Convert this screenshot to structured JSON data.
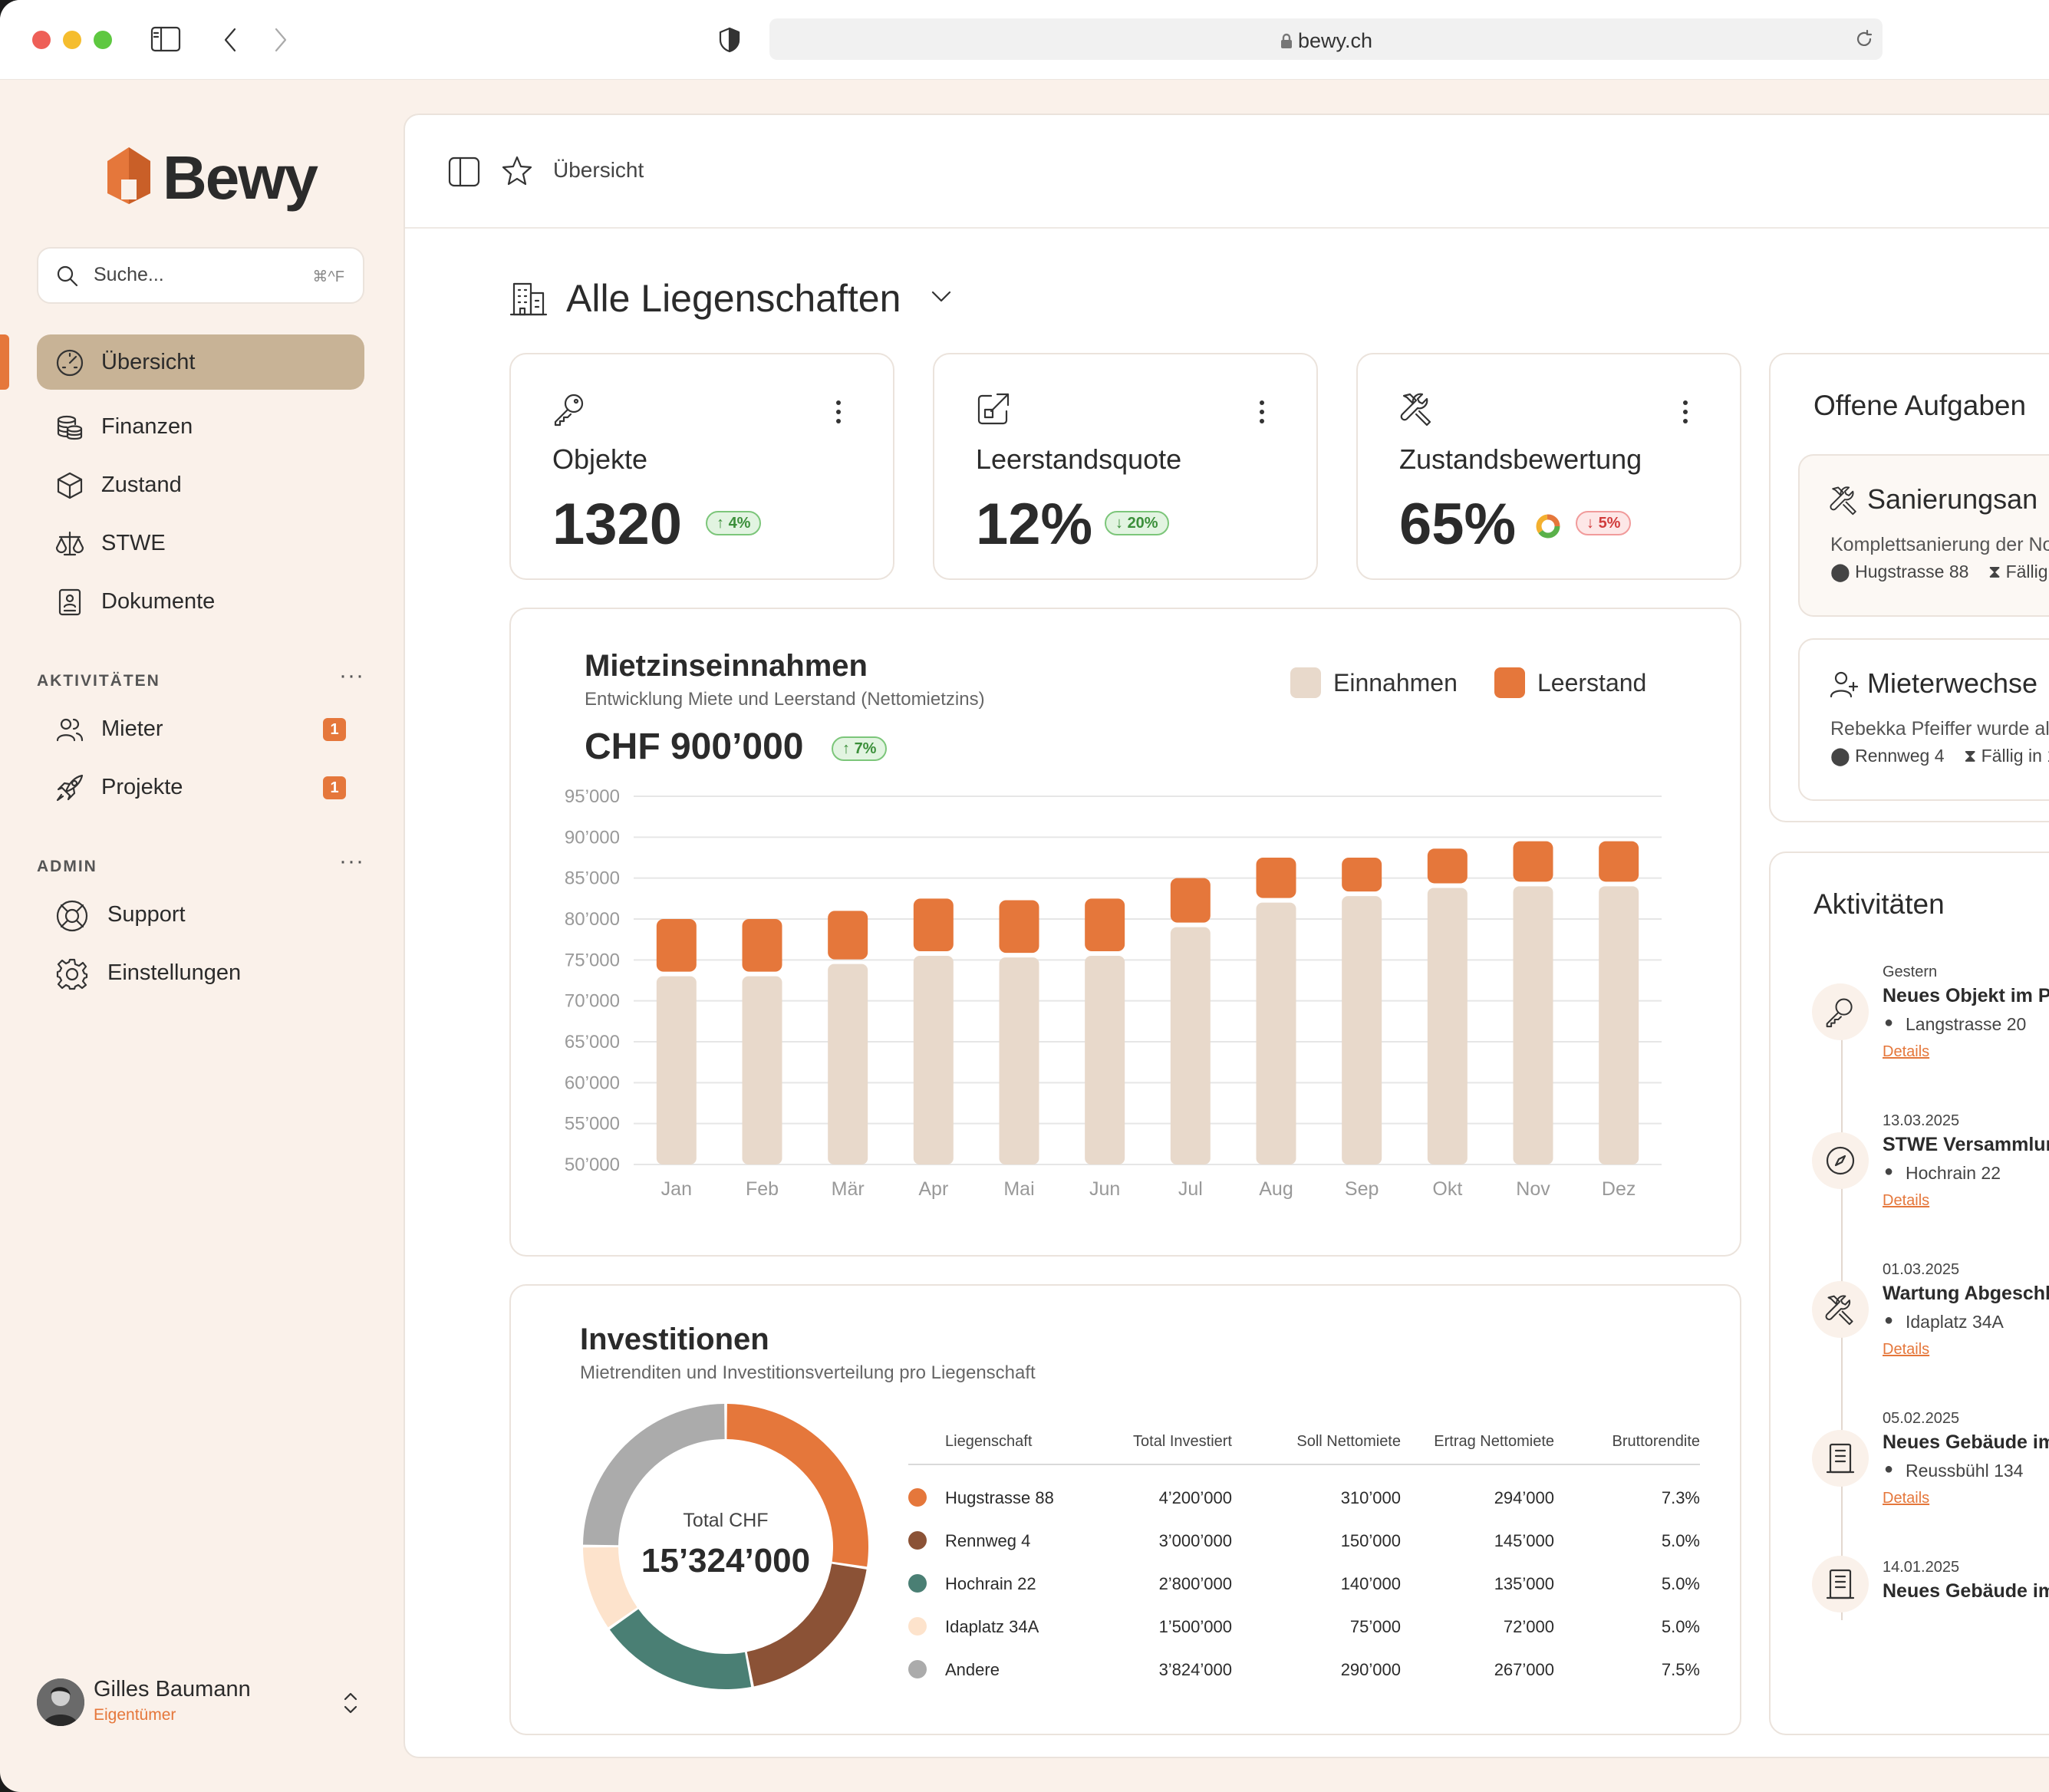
{
  "browser": {
    "url": "bewy.ch"
  },
  "brand": {
    "name": "Bewy",
    "accent": "#e5773b",
    "active_nav": "#c8b396"
  },
  "search": {
    "placeholder": "Suche...",
    "shortcut": "⌘^F"
  },
  "nav": {
    "main": [
      {
        "label": "Übersicht",
        "icon": "gauge-icon",
        "active": true
      },
      {
        "label": "Finanzen",
        "icon": "coins-icon"
      },
      {
        "label": "Zustand",
        "icon": "cube-icon"
      },
      {
        "label": "STWE",
        "icon": "scale-icon"
      },
      {
        "label": "Dokumente",
        "icon": "document-icon"
      }
    ],
    "activities_label": "AKTIVITÄTEN",
    "activities": [
      {
        "label": "Mieter",
        "icon": "users-icon",
        "badge": "1"
      },
      {
        "label": "Projekte",
        "icon": "rocket-icon",
        "badge": "1"
      }
    ],
    "admin_label": "ADMIN",
    "admin": [
      {
        "label": "Support",
        "icon": "lifebuoy-icon"
      },
      {
        "label": "Einstellungen",
        "icon": "gear-icon"
      }
    ]
  },
  "user": {
    "name": "Gilles Baumann",
    "role": "Eigentümer"
  },
  "header": {
    "breadcrumb": "Übersicht"
  },
  "page": {
    "title": "Alle Liegenschaften"
  },
  "kpis": [
    {
      "label": "Objekte",
      "value": "1320",
      "change": "4%",
      "direction": "up",
      "icon": "key-icon"
    },
    {
      "label": "Leerstandsquote",
      "value": "12%",
      "change": "20%",
      "direction": "down",
      "icon": "external-link-icon"
    },
    {
      "label": "Zustandsbewertung",
      "value": "65%",
      "change": "5%",
      "direction": "down",
      "icon": "tools-icon"
    }
  ],
  "rent_chart": {
    "title": "Mietzinseinnahmen",
    "subtitle": "Entwicklung Miete und Leerstand (Nettomietzins)",
    "total": "CHF 900’000",
    "change": "7%",
    "legend": [
      "Einnahmen",
      "Leerstand"
    ]
  },
  "chart_data": {
    "type": "bar",
    "stacked": true,
    "categories": [
      "Jan",
      "Feb",
      "Mär",
      "Apr",
      "Mai",
      "Jun",
      "Jul",
      "Aug",
      "Sep",
      "Okt",
      "Nov",
      "Dez"
    ],
    "series": [
      {
        "name": "Einnahmen",
        "color": "#e8d9cb",
        "values": [
          73000,
          73000,
          74500,
          75500,
          75300,
          75500,
          79000,
          82000,
          82800,
          83800,
          84000,
          84000
        ]
      },
      {
        "name": "Leerstand",
        "color": "#e5773b",
        "values": [
          7000,
          7000,
          6500,
          7000,
          7000,
          7000,
          6000,
          5500,
          4700,
          4800,
          5500,
          5500
        ]
      }
    ],
    "ylim": [
      50000,
      95000
    ],
    "yticks": [
      "95’000",
      "90’000",
      "85’000",
      "80’000",
      "75’000",
      "70’000",
      "65’000",
      "60’000",
      "55’000",
      "50’000"
    ],
    "grid": true,
    "legend_position": "top-right"
  },
  "investments": {
    "title": "Investitionen",
    "subtitle": "Mietrenditen und Investitionsverteilung pro Liegenschaft",
    "donut_label": "Total CHF",
    "donut_value": "15’324’000",
    "headers": [
      "Liegenschaft",
      "Total Investiert",
      "Soll Nettomiete",
      "Ertrag Nettomiete",
      "Bruttorendite"
    ],
    "rows": [
      {
        "name": "Hugstrasse 88",
        "invested": "4’200’000",
        "soll": "310’000",
        "ertrag": "294’000",
        "rendite": "7.3%",
        "color": "#e5773b",
        "amount": 4200000
      },
      {
        "name": "Rennweg 4",
        "invested": "3’000’000",
        "soll": "150’000",
        "ertrag": "145’000",
        "rendite": "5.0%",
        "color": "#8b5236",
        "amount": 3000000
      },
      {
        "name": "Hochrain 22",
        "invested": "2’800’000",
        "soll": "140’000",
        "ertrag": "135’000",
        "rendite": "5.0%",
        "color": "#4a7f74",
        "amount": 2800000
      },
      {
        "name": "Idaplatz 34A",
        "invested": "1’500’000",
        "soll": "75’000",
        "ertrag": "72’000",
        "rendite": "5.0%",
        "color": "#fde3cc",
        "amount": 1500000
      },
      {
        "name": "Andere",
        "invested": "3’824’000",
        "soll": "290’000",
        "ertrag": "267’000",
        "rendite": "7.5%",
        "color": "#ababab",
        "amount": 3824000
      }
    ]
  },
  "tasks": {
    "title": "Offene Aufgaben",
    "items": [
      {
        "title": "Sanierungsan",
        "desc": "Komplettsanierung der No",
        "location": "Hugstrasse 88",
        "due": "Fällig",
        "icon": "tools-icon"
      },
      {
        "title": "Mieterwechse",
        "desc": "Rebekka Pfeiffer wurde al",
        "location": "Rennweg 4",
        "due": "Fällig in 1",
        "icon": "user-plus-icon"
      }
    ]
  },
  "activities": {
    "title": "Aktivitäten",
    "items": [
      {
        "date": "Gestern",
        "title": "Neues Objekt im Po",
        "location": "Langstrasse 20",
        "link": "Details",
        "icon": "key-icon"
      },
      {
        "date": "13.03.2025",
        "title": "STWE Versammlun",
        "location": "Hochrain 22",
        "link": "Details",
        "icon": "compass-icon"
      },
      {
        "date": "01.03.2025",
        "title": "Wartung Abgeschl",
        "location": "Idaplatz 34A",
        "link": "Details",
        "icon": "tools-icon"
      },
      {
        "date": "05.02.2025",
        "title": "Neues Gebäude im",
        "location": "Reussbühl 134",
        "link": "Details",
        "icon": "building-icon"
      },
      {
        "date": "14.01.2025",
        "title": "Neues Gebäude im",
        "location": "",
        "link": "",
        "icon": "building-icon"
      }
    ]
  }
}
